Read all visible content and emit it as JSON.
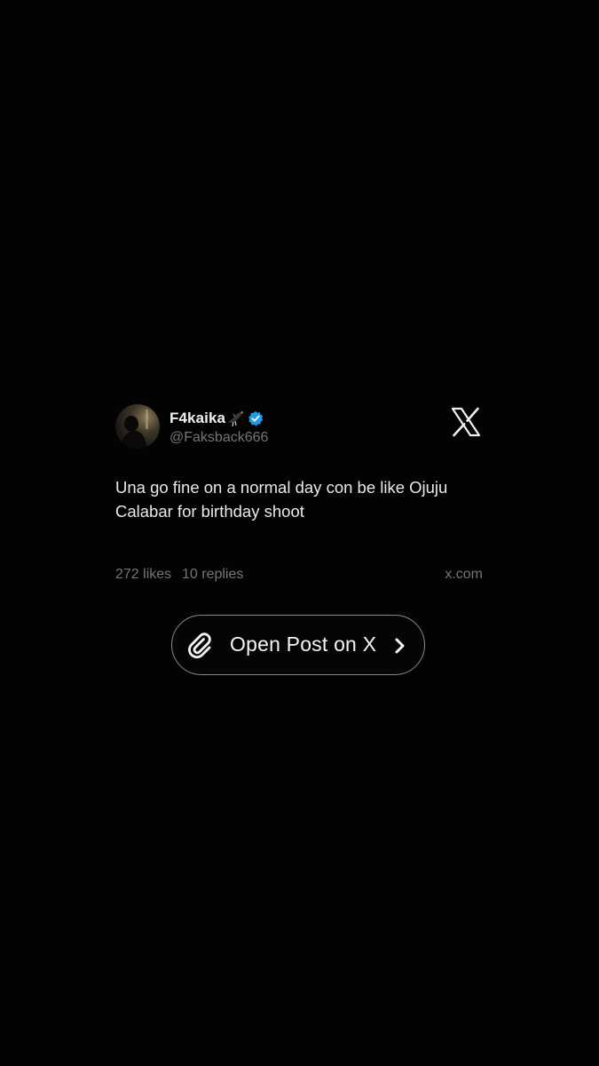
{
  "post": {
    "author": {
      "display_name": "F4kaika",
      "handle": "@Faksback666",
      "verified": true,
      "emoji": "bird-emoji"
    },
    "text": "Una go fine on a normal day con be like Ojuju Calabar for birthday shoot",
    "likes": "272 likes",
    "replies": "10 replies",
    "domain": "x.com"
  },
  "button": {
    "label": "Open Post on X",
    "icon": "paperclip-icon",
    "trailing_icon": "chevron-right-icon"
  },
  "colors": {
    "background": "#030303",
    "text_primary": "#e7e9ea",
    "text_secondary": "#71767b",
    "verified_blue": "#1d9bf0",
    "button_border": "#8a8a8a"
  }
}
